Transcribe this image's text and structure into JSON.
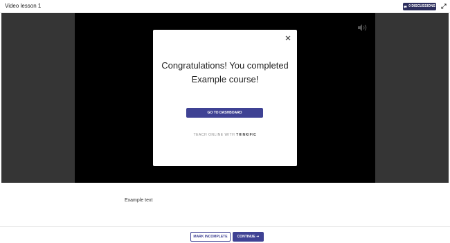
{
  "header": {
    "title": "Video lesson 1",
    "discussions_label": "0 DISCUSSIONS",
    "discussions_icon": "chat-bubble-icon",
    "expand_icon": "expand-icon"
  },
  "player": {
    "volume_icon": "volume-icon"
  },
  "modal": {
    "headline": "Congratulations! You completed Example course!",
    "dashboard_button": "GO TO DASHBOARD",
    "powered_by": "TEACH ONLINE WITH",
    "brand": "THINKIFIC",
    "close_icon": "close-icon"
  },
  "content": {
    "text": "Example text"
  },
  "footer": {
    "mark_incomplete": "MARK INCOMPLETE",
    "continue": "CONTINUE",
    "continue_icon": "arrow-right-icon"
  },
  "colors": {
    "brand_navy": "#2d2f5e",
    "accent": "#3f4294",
    "stage_gray": "#353535"
  }
}
